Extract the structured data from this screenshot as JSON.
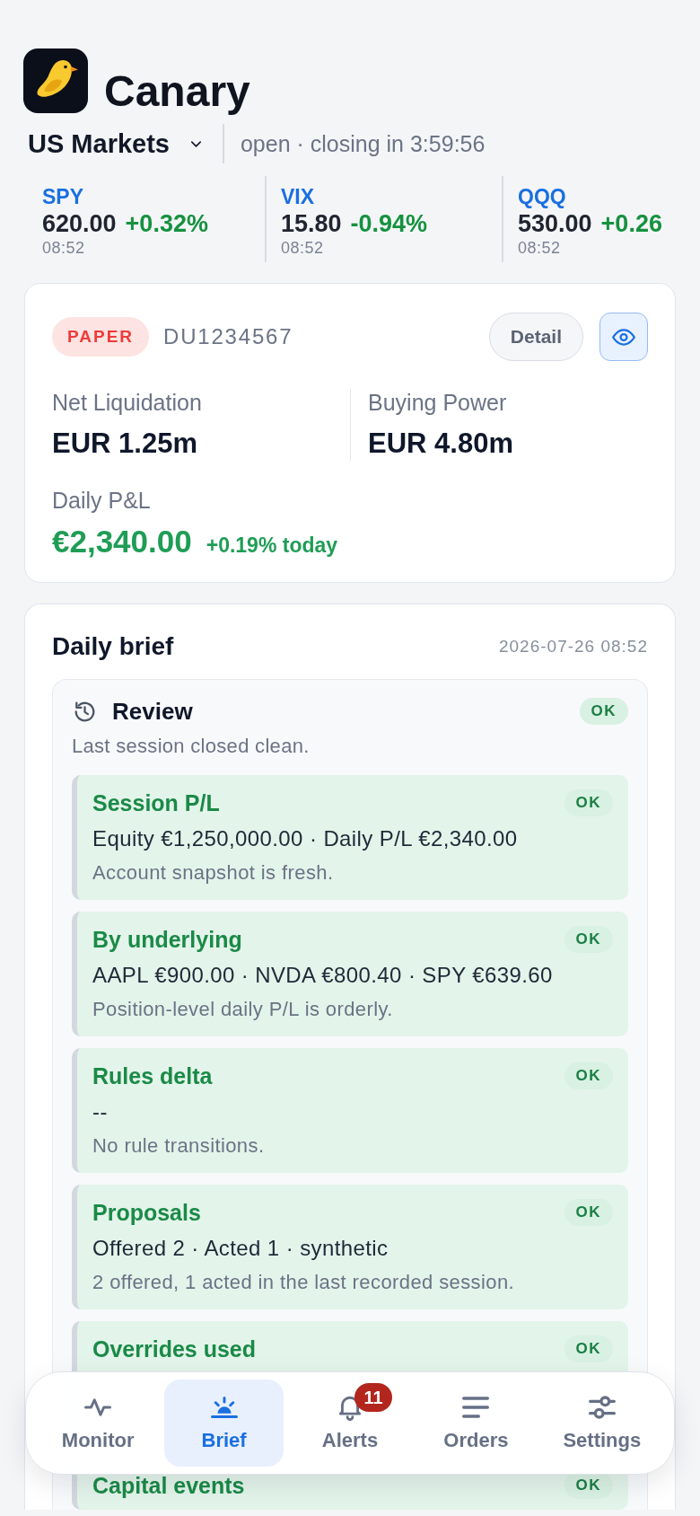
{
  "app": {
    "name": "Canary"
  },
  "market": {
    "name": "US Markets",
    "status": "open · closing in 3:59:56"
  },
  "tickers": [
    {
      "symbol": "SPY",
      "price": "620.00",
      "change": "+0.32%",
      "time": "08:52"
    },
    {
      "symbol": "VIX",
      "price": "15.80",
      "change": "-0.94%",
      "time": "08:52"
    },
    {
      "symbol": "QQQ",
      "price": "530.00",
      "change": "+0.26",
      "time": "08:52"
    }
  ],
  "account": {
    "mode": "PAPER",
    "account_number": "DU1234567",
    "detail_button": "Detail",
    "view_toggle": {
      "on": true
    },
    "metrics": [
      {
        "label": "Net Liquidation",
        "value": "EUR 1.25m"
      },
      {
        "label": "Buying Power",
        "value": "EUR 4.80m"
      }
    ],
    "daily_pnl": {
      "label": "Daily P&L",
      "value": "€2,340.00",
      "change": "+0.19% today"
    }
  },
  "daily_brief": {
    "title": "Daily brief",
    "timestamp": "2026-07-26 08:52",
    "review": {
      "title": "Review",
      "status": "OK",
      "summary": "Last session closed clean.",
      "items": [
        {
          "title": "Session P/L",
          "status": "OK",
          "value": "Equity €1,250,000.00 · Daily P/L €2,340.00",
          "note": "Account snapshot is fresh."
        },
        {
          "title": "By underlying",
          "status": "OK",
          "value": "AAPL €900.00 · NVDA €800.40 · SPY €639.60",
          "note": "Position-level daily P/L is orderly."
        },
        {
          "title": "Rules delta",
          "status": "OK",
          "value": "--",
          "note": "No rule transitions."
        },
        {
          "title": "Proposals",
          "status": "OK",
          "value": "Offered 2 · Acted 1 · synthetic",
          "note": "2 offered, 1 acted in the last recorded session."
        },
        {
          "title": "Overrides used",
          "status": "OK"
        },
        {
          "title": "Capital events",
          "status": "OK"
        }
      ]
    }
  },
  "tab_bar": [
    {
      "label": "Monitor",
      "selected": false
    },
    {
      "label": "Brief",
      "selected": true
    },
    {
      "label": "Alerts",
      "selected": false,
      "badge": "11"
    },
    {
      "label": "Orders",
      "selected": false
    },
    {
      "label": "Settings",
      "selected": false
    }
  ]
}
